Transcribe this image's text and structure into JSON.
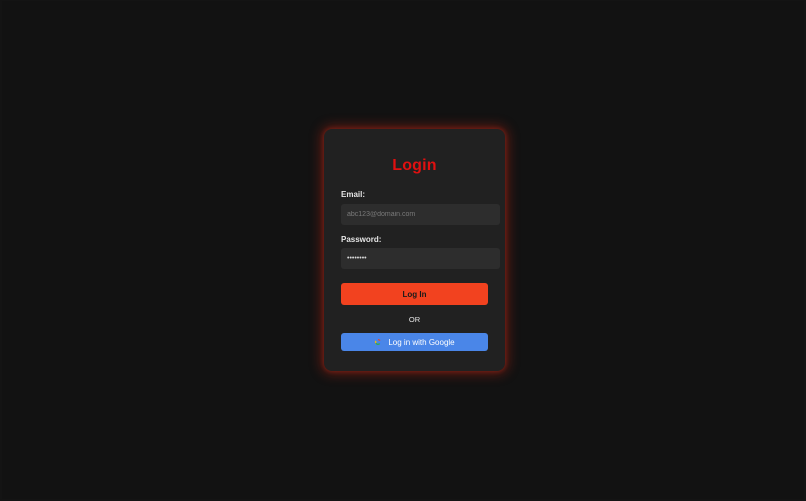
{
  "login": {
    "title": "Login",
    "email_label": "Email:",
    "email_placeholder": "abc123@domain.com",
    "password_label": "Password:",
    "password_value": "password",
    "submit_label": "Log In",
    "separator": "OR",
    "google_label": "Log in with Google",
    "google_icon": "google-g-icon"
  },
  "colors": {
    "background": "#121212",
    "card": "#212121",
    "title": "#e01010",
    "primary_button": "#f2421f",
    "google_button": "#4a86e8"
  }
}
